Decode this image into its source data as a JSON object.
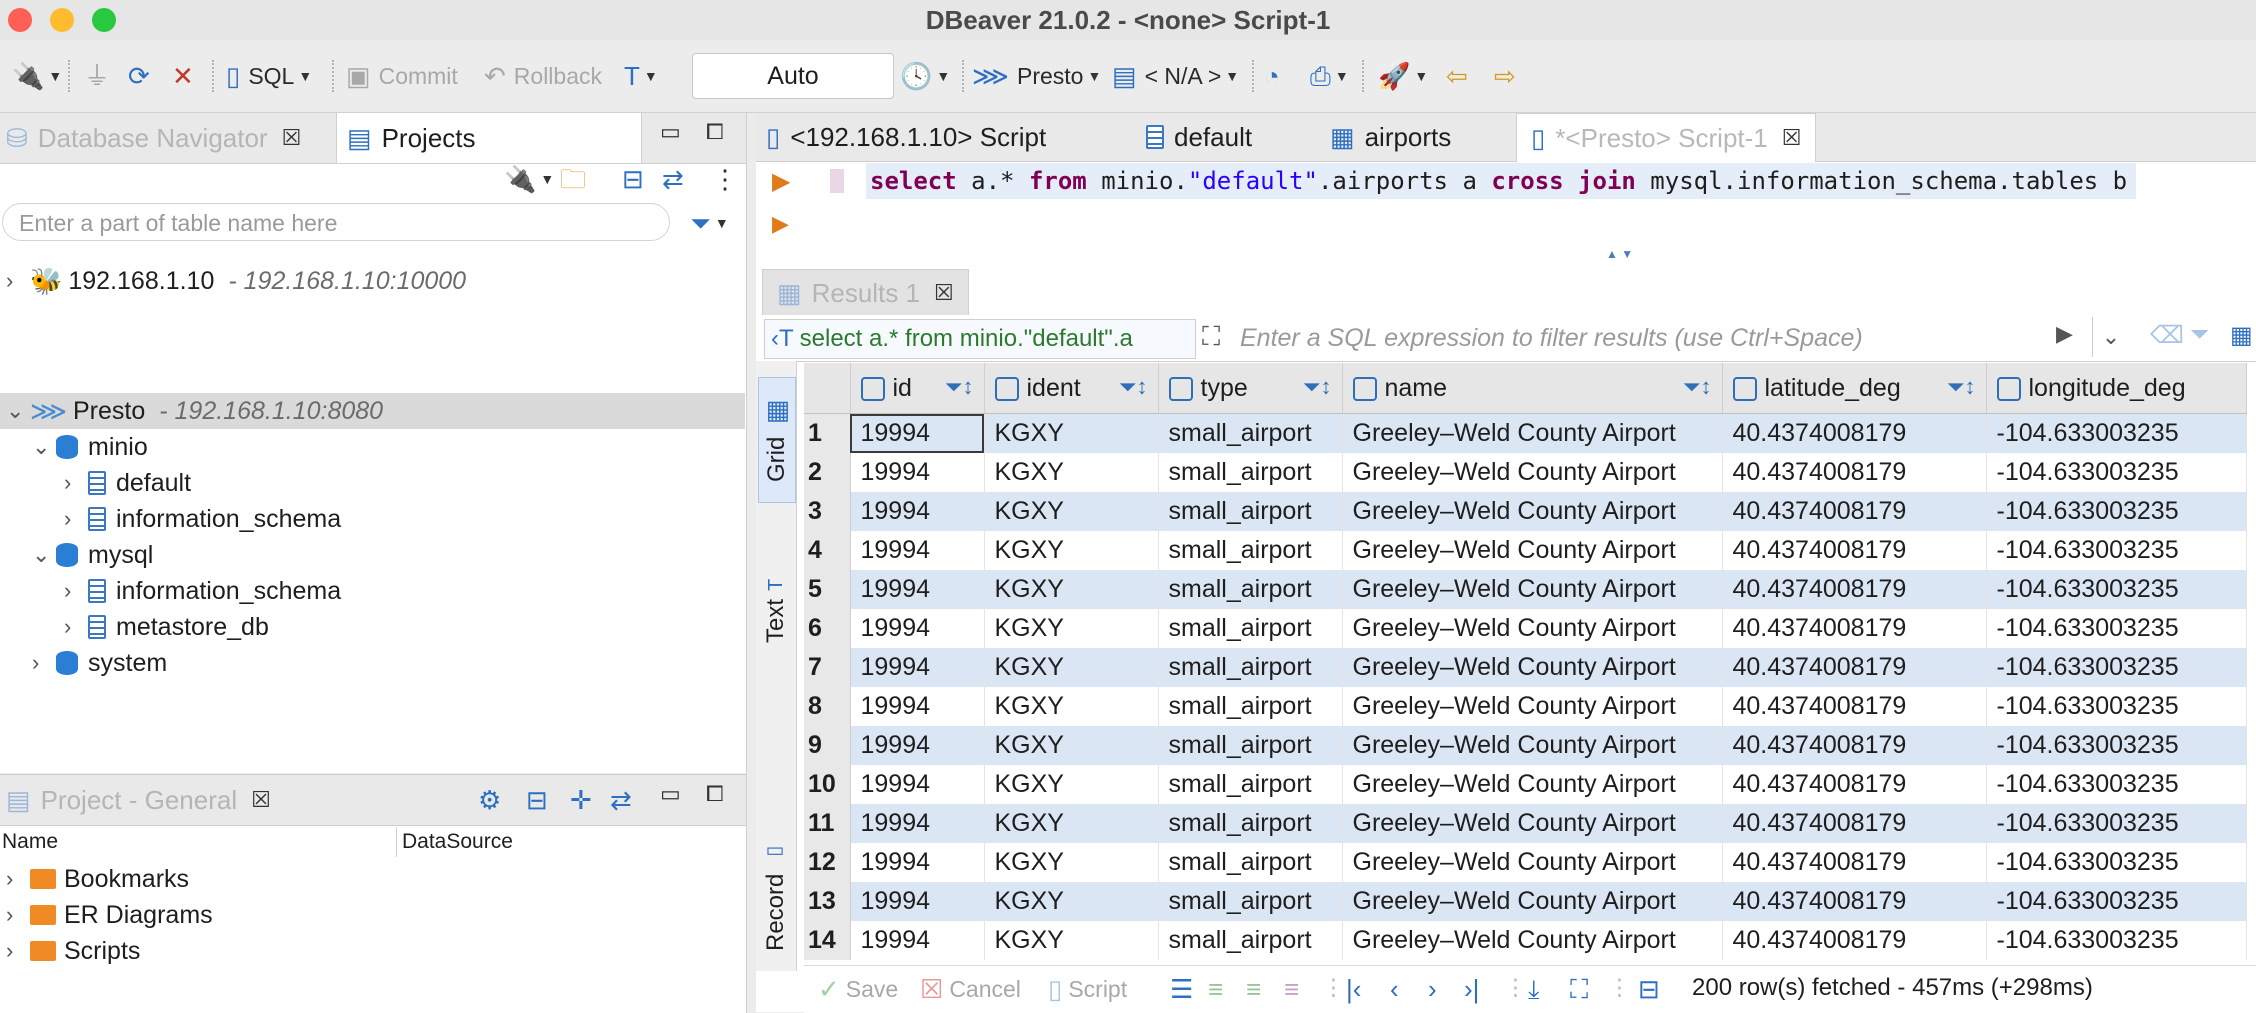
{
  "window": {
    "title": "DBeaver 21.0.2 - <none> Script-1"
  },
  "toolbar": {
    "sql_label": "SQL",
    "commit_label": "Commit",
    "rollback_label": "Rollback",
    "transaction_mode": "Auto",
    "datasource_label": "Presto",
    "schema_label": "< N/A >"
  },
  "navigator": {
    "tab_db": "Database Navigator",
    "tab_projects": "Projects",
    "filter_placeholder": "Enter a part of table name here",
    "tree": [
      {
        "label": "192.168.1.10",
        "sub": "- 192.168.1.10:10000"
      },
      {
        "label": "Presto",
        "sub": "- 192.168.1.10:8080"
      },
      {
        "label": "minio"
      },
      {
        "label": "default"
      },
      {
        "label": "information_schema"
      },
      {
        "label": "mysql"
      },
      {
        "label": "information_schema"
      },
      {
        "label": "metastore_db"
      },
      {
        "label": "system"
      }
    ]
  },
  "project": {
    "tab_label": "Project - General",
    "col_name": "Name",
    "col_datasource": "DataSource",
    "items": [
      "Bookmarks",
      "ER Diagrams",
      "Scripts"
    ]
  },
  "editor": {
    "tabs": [
      "<192.168.1.10> Script",
      "default",
      "airports",
      "*<Presto> Script-1"
    ],
    "sql": {
      "k1": "select",
      "t1": " a.* ",
      "k2": "from",
      "t2": " minio.",
      "s1": "\"default\"",
      "t3": ".airports a ",
      "k3": "cross join",
      "t4": " mysql.information_schema.tables b"
    }
  },
  "results": {
    "tab_label": "Results 1",
    "query_text": "select a.* from minio.\"default\".a",
    "filter_placeholder": "Enter a SQL expression to filter results (use Ctrl+Space)",
    "side_tabs": {
      "grid": "Grid",
      "text": "Text",
      "record": "Record"
    },
    "columns": [
      "id",
      "ident",
      "type",
      "name",
      "latitude_deg",
      "longitude_deg"
    ],
    "rows": [
      [
        "1",
        "19994",
        "KGXY",
        "small_airport",
        "Greeley–Weld County Airport",
        "40.4374008179",
        "-104.633003235"
      ],
      [
        "2",
        "19994",
        "KGXY",
        "small_airport",
        "Greeley–Weld County Airport",
        "40.4374008179",
        "-104.633003235"
      ],
      [
        "3",
        "19994",
        "KGXY",
        "small_airport",
        "Greeley–Weld County Airport",
        "40.4374008179",
        "-104.633003235"
      ],
      [
        "4",
        "19994",
        "KGXY",
        "small_airport",
        "Greeley–Weld County Airport",
        "40.4374008179",
        "-104.633003235"
      ],
      [
        "5",
        "19994",
        "KGXY",
        "small_airport",
        "Greeley–Weld County Airport",
        "40.4374008179",
        "-104.633003235"
      ],
      [
        "6",
        "19994",
        "KGXY",
        "small_airport",
        "Greeley–Weld County Airport",
        "40.4374008179",
        "-104.633003235"
      ],
      [
        "7",
        "19994",
        "KGXY",
        "small_airport",
        "Greeley–Weld County Airport",
        "40.4374008179",
        "-104.633003235"
      ],
      [
        "8",
        "19994",
        "KGXY",
        "small_airport",
        "Greeley–Weld County Airport",
        "40.4374008179",
        "-104.633003235"
      ],
      [
        "9",
        "19994",
        "KGXY",
        "small_airport",
        "Greeley–Weld County Airport",
        "40.4374008179",
        "-104.633003235"
      ],
      [
        "10",
        "19994",
        "KGXY",
        "small_airport",
        "Greeley–Weld County Airport",
        "40.4374008179",
        "-104.633003235"
      ],
      [
        "11",
        "19994",
        "KGXY",
        "small_airport",
        "Greeley–Weld County Airport",
        "40.4374008179",
        "-104.633003235"
      ],
      [
        "12",
        "19994",
        "KGXY",
        "small_airport",
        "Greeley–Weld County Airport",
        "40.4374008179",
        "-104.633003235"
      ],
      [
        "13",
        "19994",
        "KGXY",
        "small_airport",
        "Greeley–Weld County Airport",
        "40.4374008179",
        "-104.633003235"
      ],
      [
        "14",
        "19994",
        "KGXY",
        "small_airport",
        "Greeley–Weld County Airport",
        "40.4374008179",
        "-104.633003235"
      ]
    ],
    "status": {
      "save": "Save",
      "cancel": "Cancel",
      "script": "Script",
      "fetched": "200 row(s) fetched - 457ms (+298ms)"
    }
  }
}
